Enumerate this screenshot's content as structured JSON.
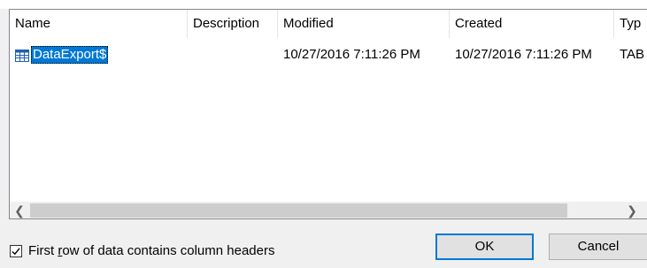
{
  "columns": [
    {
      "label": "Name"
    },
    {
      "label": "Description"
    },
    {
      "label": "Modified"
    },
    {
      "label": "Created"
    },
    {
      "label": "Typ"
    }
  ],
  "rows": [
    {
      "name": "DataExport$",
      "icon": "table-icon",
      "description": "",
      "modified": "10/27/2016 7:11:26 PM",
      "created": "10/27/2016 7:11:26 PM",
      "type": "TAB"
    }
  ],
  "checkbox": {
    "label_before": "First ",
    "label_underlined": "r",
    "label_after": "ow of data contains column headers",
    "checked": true
  },
  "buttons": {
    "ok_label": "OK",
    "cancel_label": "Cancel"
  },
  "colors": {
    "selection": "#0078d7",
    "default_button_border": "#0078d7"
  }
}
